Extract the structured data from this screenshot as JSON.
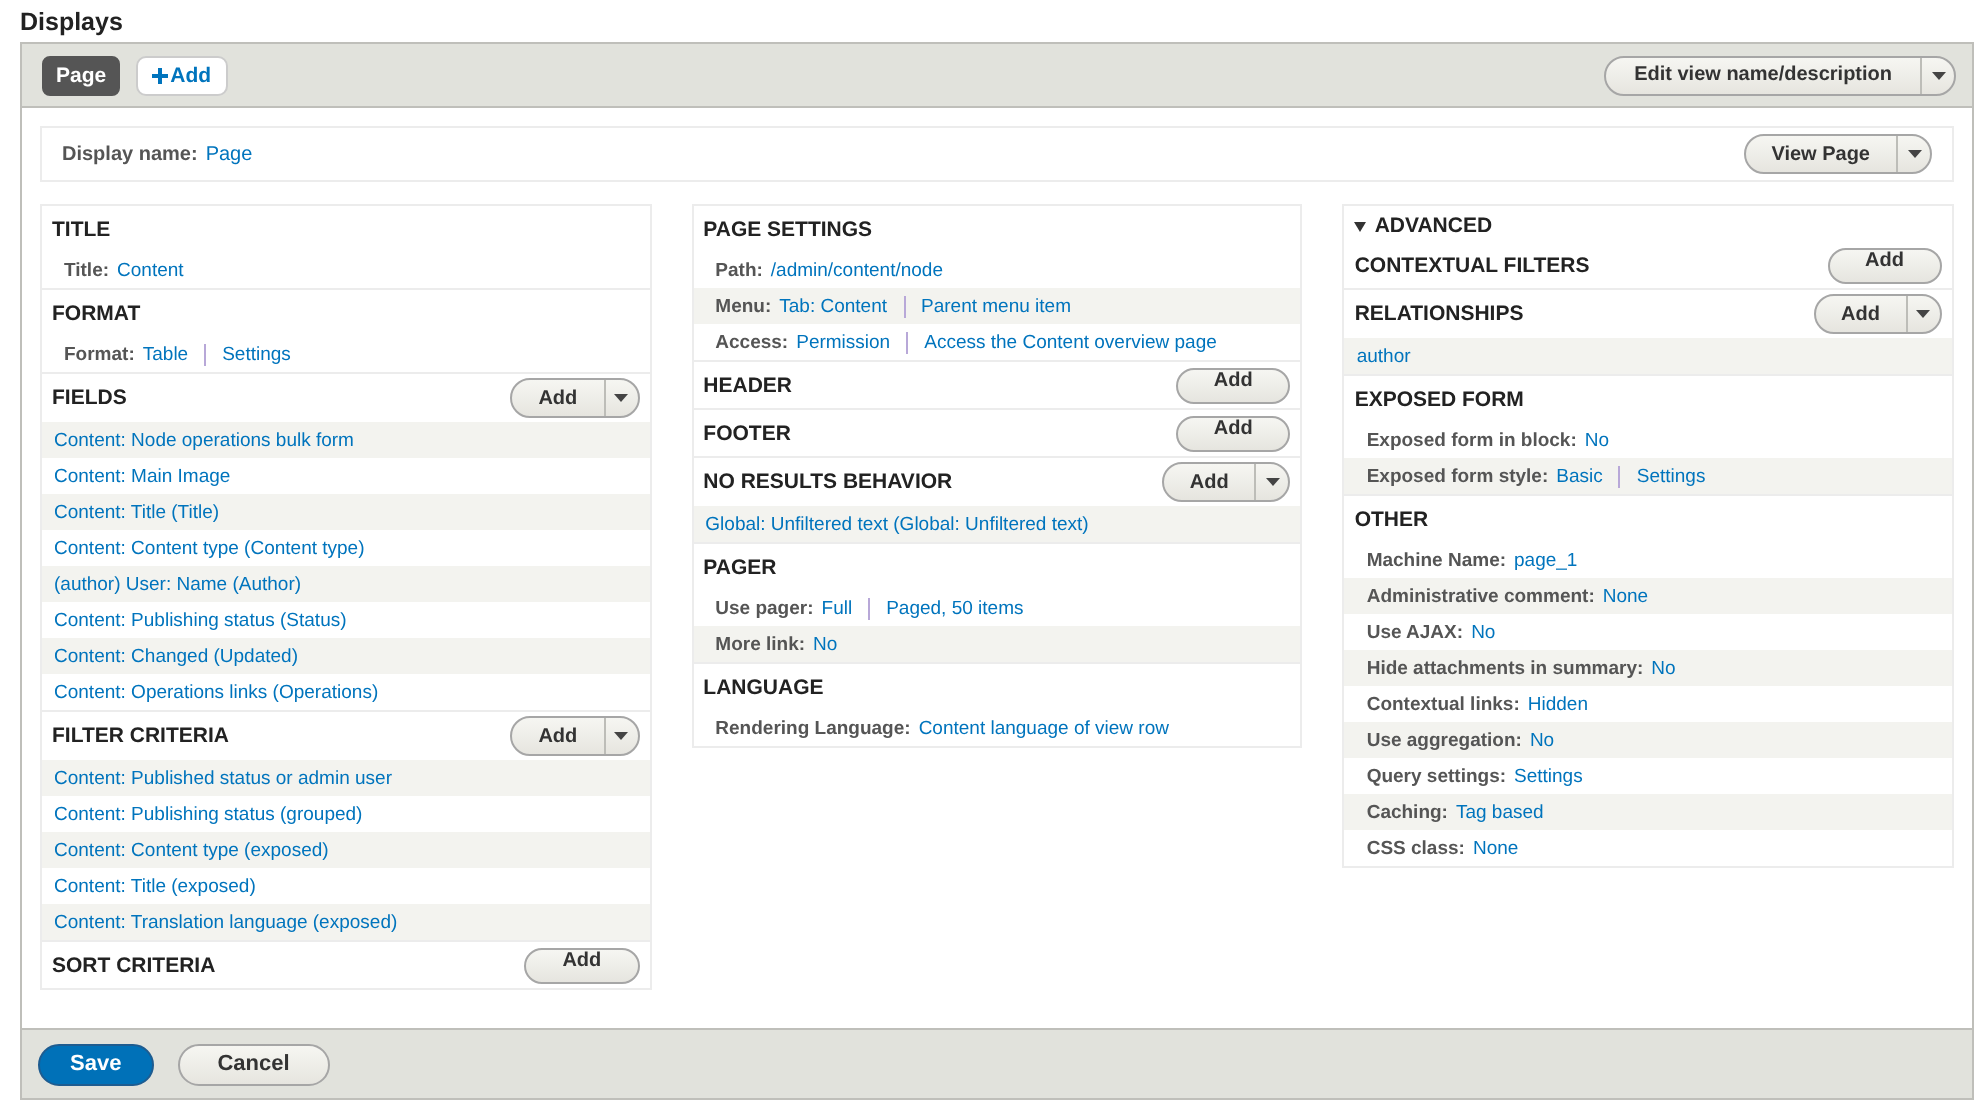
{
  "page_title": "Displays",
  "display_tabs": [
    {
      "label": "Page",
      "selected": true
    }
  ],
  "add_display_button": {
    "label": "Add"
  },
  "edit_button": {
    "label": "Edit view name/description",
    "dropdown": true
  },
  "display_name": {
    "label": "Display name:",
    "value": "Page"
  },
  "view_button": {
    "label": "View Page",
    "dropdown": true
  },
  "columns": [
    {
      "sections": [
        {
          "title": "TITLE",
          "rows": [
            {
              "kind": "setting",
              "label": "Title:",
              "values": [
                "Content"
              ]
            }
          ]
        },
        {
          "title": "FORMAT",
          "rows": [
            {
              "kind": "setting",
              "label": "Format:",
              "values": [
                "Table",
                "Settings"
              ]
            }
          ]
        },
        {
          "title": "FIELDS",
          "add": {
            "label": "Add",
            "dropdown": true
          },
          "rows": [
            {
              "kind": "link",
              "text": "Content: Node operations bulk form"
            },
            {
              "kind": "link",
              "text": "Content: Main Image"
            },
            {
              "kind": "link",
              "text": "Content: Title (Title)"
            },
            {
              "kind": "link",
              "text": "Content: Content type (Content type)"
            },
            {
              "kind": "link",
              "text": "(author) User: Name (Author)"
            },
            {
              "kind": "link",
              "text": "Content: Publishing status (Status)"
            },
            {
              "kind": "link",
              "text": "Content: Changed (Updated)"
            },
            {
              "kind": "link",
              "text": "Content: Operations links (Operations)"
            }
          ]
        },
        {
          "title": "FILTER CRITERIA",
          "add": {
            "label": "Add",
            "dropdown": true
          },
          "rows": [
            {
              "kind": "link",
              "text": "Content: Published status or admin user"
            },
            {
              "kind": "link",
              "text": "Content: Publishing status (grouped)"
            },
            {
              "kind": "link",
              "text": "Content: Content type (exposed)"
            },
            {
              "kind": "link",
              "text": "Content: Title (exposed)"
            },
            {
              "kind": "link",
              "text": "Content: Translation language (exposed)"
            }
          ]
        },
        {
          "title": "SORT CRITERIA",
          "add": {
            "label": "Add",
            "dropdown": false
          }
        }
      ]
    },
    {
      "sections": [
        {
          "title": "PAGE SETTINGS",
          "rows": [
            {
              "kind": "setting",
              "label": "Path:",
              "values": [
                "/admin/content/node"
              ]
            },
            {
              "kind": "setting",
              "label": "Menu:",
              "values": [
                "Tab: Content",
                "Parent menu item"
              ]
            },
            {
              "kind": "setting",
              "label": "Access:",
              "values": [
                "Permission",
                "Access the Content overview page"
              ]
            }
          ]
        },
        {
          "title": "HEADER",
          "add": {
            "label": "Add",
            "dropdown": false
          }
        },
        {
          "title": "FOOTER",
          "add": {
            "label": "Add",
            "dropdown": false
          }
        },
        {
          "title": "NO RESULTS BEHAVIOR",
          "add": {
            "label": "Add",
            "dropdown": true
          },
          "rows": [
            {
              "kind": "link",
              "text": "Global: Unfiltered text (Global: Unfiltered text)"
            }
          ]
        },
        {
          "title": "PAGER",
          "rows": [
            {
              "kind": "setting",
              "label": "Use pager:",
              "values": [
                "Full",
                "Paged, 50 items"
              ]
            },
            {
              "kind": "setting",
              "label": "More link:",
              "values": [
                "No"
              ]
            }
          ]
        },
        {
          "title": "LANGUAGE",
          "rows": [
            {
              "kind": "setting",
              "label": "Rendering Language:",
              "values": [
                "Content language of view row"
              ]
            }
          ]
        }
      ]
    },
    {
      "advanced": {
        "label": "ADVANCED",
        "expanded": true
      },
      "sections": [
        {
          "title": "CONTEXTUAL FILTERS",
          "add": {
            "label": "Add",
            "dropdown": false
          }
        },
        {
          "title": "RELATIONSHIPS",
          "add": {
            "label": "Add",
            "dropdown": true
          },
          "rows": [
            {
              "kind": "link",
              "text": "author"
            }
          ]
        },
        {
          "title": "EXPOSED FORM",
          "rows": [
            {
              "kind": "setting",
              "label": "Exposed form in block:",
              "values": [
                "No"
              ]
            },
            {
              "kind": "setting",
              "label": "Exposed form style:",
              "values": [
                "Basic",
                "Settings"
              ]
            }
          ]
        },
        {
          "title": "OTHER",
          "rows": [
            {
              "kind": "setting",
              "label": "Machine Name:",
              "values": [
                "page_1"
              ]
            },
            {
              "kind": "setting",
              "label": "Administrative comment:",
              "values": [
                "None"
              ]
            },
            {
              "kind": "setting",
              "label": "Use AJAX:",
              "values": [
                "No"
              ]
            },
            {
              "kind": "setting",
              "label": "Hide attachments in summary:",
              "values": [
                "No"
              ]
            },
            {
              "kind": "setting",
              "label": "Contextual links:",
              "values": [
                "Hidden"
              ]
            },
            {
              "kind": "setting",
              "label": "Use aggregation:",
              "values": [
                "No"
              ]
            },
            {
              "kind": "setting",
              "label": "Query settings:",
              "values": [
                "Settings"
              ]
            },
            {
              "kind": "setting",
              "label": "Caching:",
              "values": [
                "Tag based"
              ]
            },
            {
              "kind": "setting",
              "label": "CSS class:",
              "values": [
                "None"
              ]
            }
          ]
        }
      ]
    }
  ],
  "actions": [
    {
      "label": "Save",
      "kind": "primary"
    },
    {
      "label": "Cancel",
      "kind": "secondary"
    }
  ]
}
